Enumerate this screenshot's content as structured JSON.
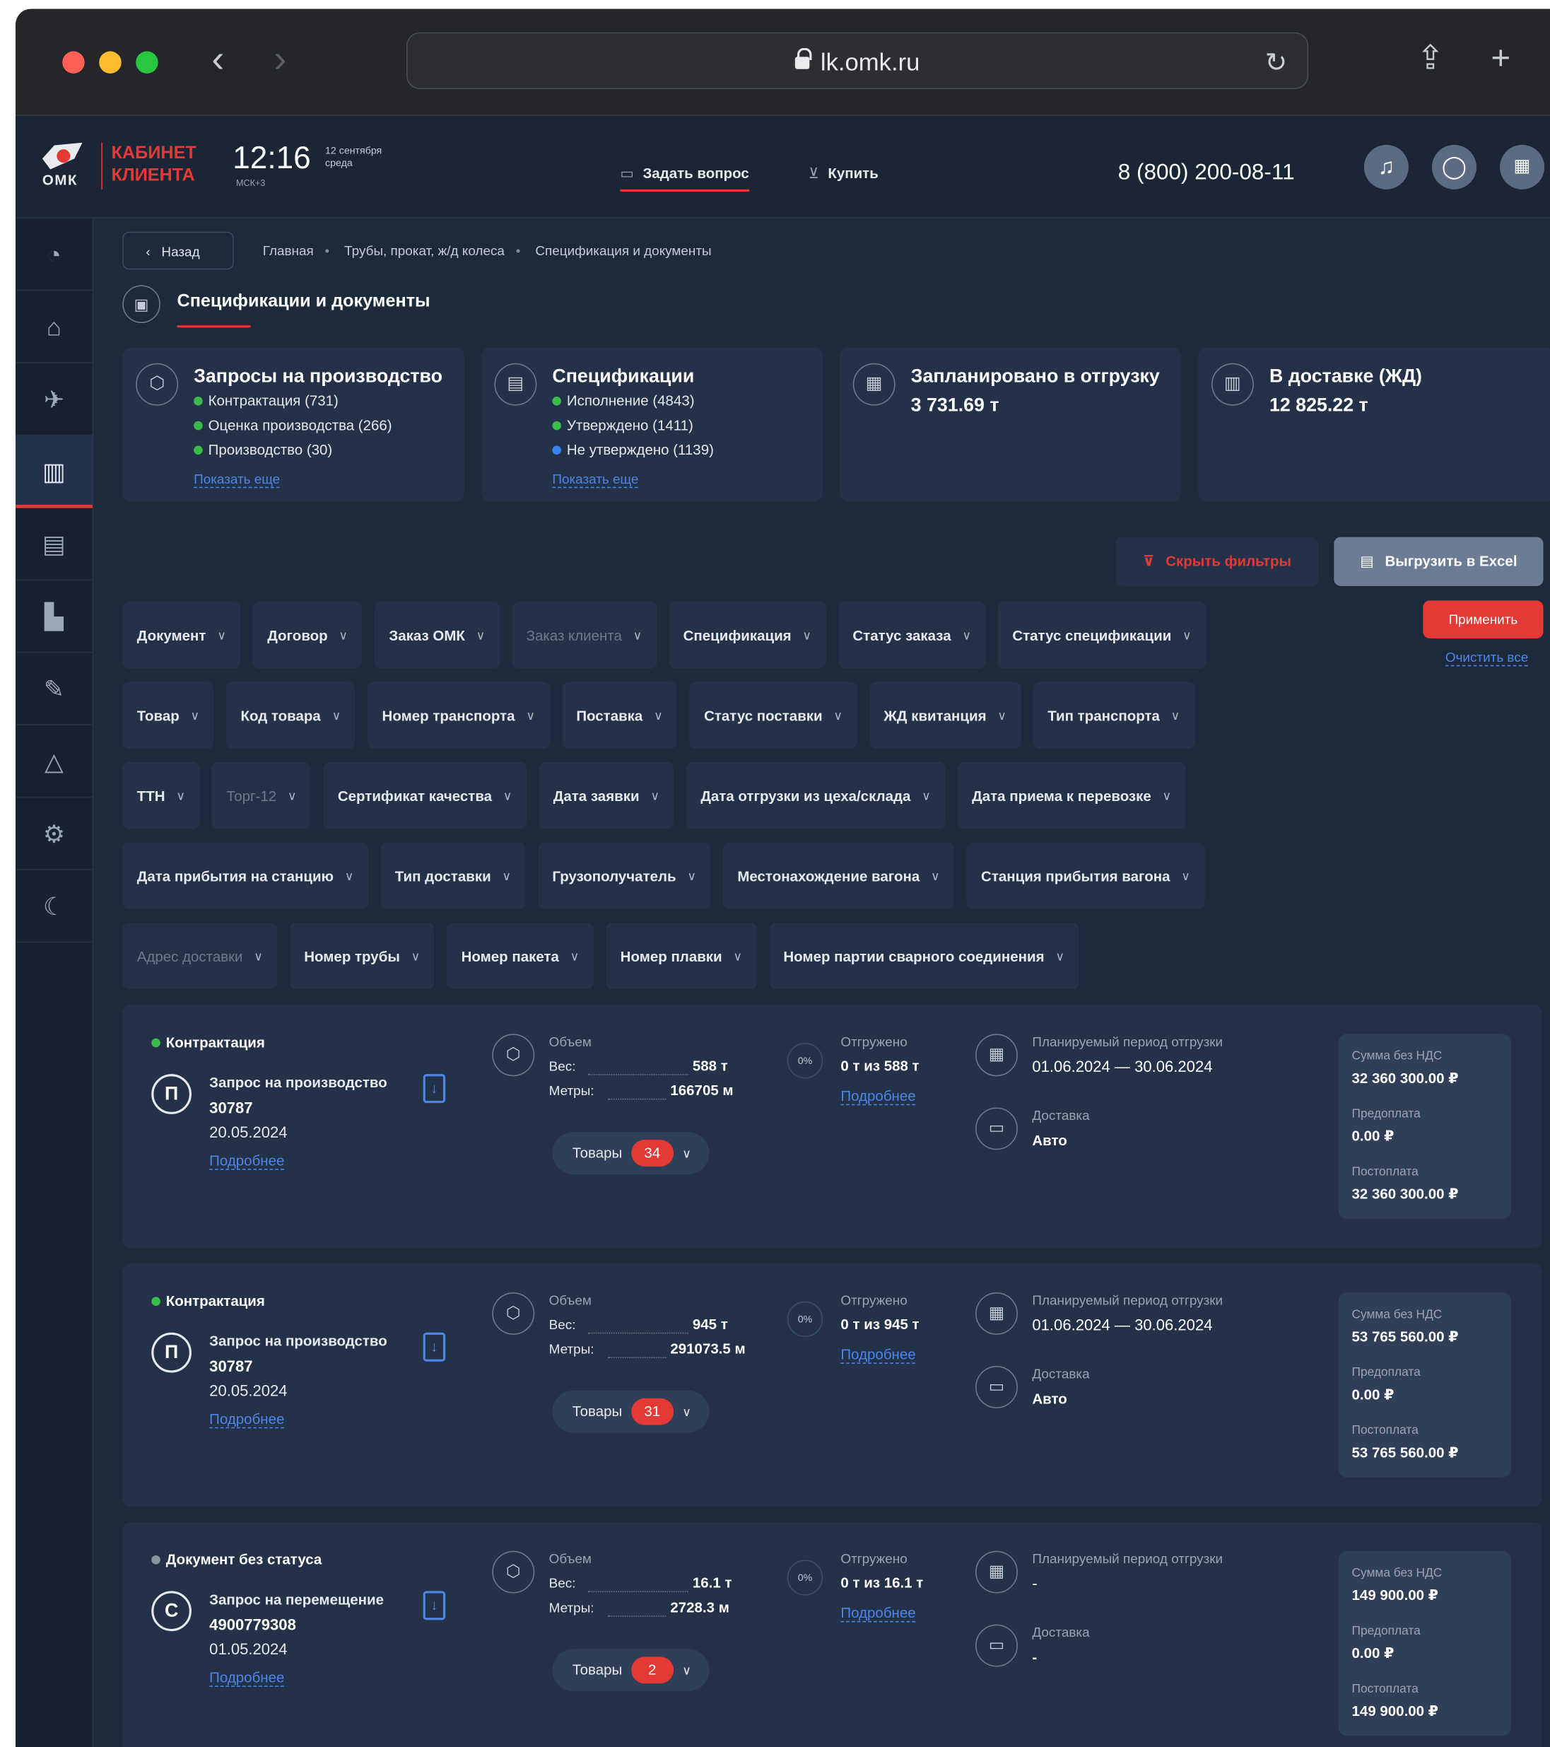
{
  "browser": {
    "url": "lk.omk.ru"
  },
  "header": {
    "logo_text": "ОМК",
    "cabinet_line1": "КАБИНЕТ",
    "cabinet_line2": "КЛИЕНТА",
    "time": "12:16",
    "date_line1": "12 сентября",
    "date_line2": "среда",
    "timezone": "МСК+3",
    "ask_label": "Задать вопрос",
    "buy_label": "Купить",
    "phone": "8 (800) 200-08-11"
  },
  "sidebar": {
    "icons": [
      "pie-chart-icon",
      "home-icon",
      "rocket-icon",
      "wagon-icon",
      "document-icon",
      "factory-icon",
      "tools-icon",
      "warning-icon",
      "settings-icon",
      "moon-icon"
    ],
    "active_index": 3
  },
  "breadcrumb": {
    "back": "Назад",
    "items": [
      "Главная",
      "Трубы, прокат, ж/д колеса",
      "Спецификация и документы"
    ]
  },
  "page_title": "Спецификации и документы",
  "summary_cards": [
    {
      "title": "Запросы на производство",
      "items": [
        {
          "text": "Контрактация (731)",
          "color": "#3dbb4a"
        },
        {
          "text": "Оценка производства (266)",
          "color": "#3dbb4a"
        },
        {
          "text": "Производство (30)",
          "color": "#3dbb4a"
        }
      ],
      "more": "Показать еще"
    },
    {
      "title": "Спецификации",
      "items": [
        {
          "text": "Исполнение (4843)",
          "color": "#3dbb4a"
        },
        {
          "text": "Утверждено (1411)",
          "color": "#3dbb4a"
        },
        {
          "text": "Не утверждено (1139)",
          "color": "#3c82f6"
        }
      ],
      "more": "Показать еще"
    },
    {
      "title": "Запланировано в отгрузку",
      "value": "3 731.69 т"
    },
    {
      "title": "В доставке (ЖД)",
      "value": "12 825.22 т"
    }
  ],
  "actions": {
    "hide_filters": "Скрыть фильтры",
    "export": "Выгрузить в Excel",
    "apply": "Применить",
    "clear": "Очистить все"
  },
  "filters": {
    "row1": [
      "Документ",
      "Договор",
      "Заказ ОМК",
      "Заказ клиента",
      "Спецификация",
      "Статус заказа",
      "Статус спецификации"
    ],
    "row2": [
      "Товар",
      "Код товара",
      "Номер транспорта",
      "Поставка",
      "Статус поставки",
      "ЖД квитанция",
      "Тип транспорта"
    ],
    "row3": [
      "ТТН",
      "Торг-12",
      "Сертификат качества",
      "Дата заявки",
      "Дата отгрузки из цеха/склада",
      "Дата приема к перевозке"
    ],
    "row4": [
      "Дата прибытия на станцию",
      "Тип доставки",
      "Грузополучатель",
      "Местонахождение вагона",
      "Станция прибытия вагона"
    ],
    "row5": [
      "Адрес доставки",
      "Номер трубы",
      "Номер пакета",
      "Номер плавки",
      "Номер партии сварного соединения"
    ]
  },
  "labels": {
    "volume": "Объем",
    "weight": "Вес:",
    "meters": "Метры:",
    "shipped": "Отгружено",
    "details": "Подробнее",
    "period": "Планируемый период отгрузки",
    "delivery": "Доставка",
    "goods": "Товары",
    "sum_no_vat": "Сумма без НДС",
    "prepay": "Предоплата",
    "postpay": "Постоплата",
    "percent": "0%"
  },
  "orders": [
    {
      "status": "Контрактация",
      "status_color": "#3dbb4a",
      "letter": "П",
      "type": "Запрос на производство",
      "number": "30787",
      "date": "20.05.2024",
      "weight": "588 т",
      "meters": "166705 м",
      "shipped": "0 т из 588 т",
      "period": "01.06.2024 — 30.06.2024",
      "delivery": "Авто",
      "goods_count": "34",
      "sum": "32 360 300.00 ₽",
      "prepay": "0.00 ₽",
      "postpay": "32 360 300.00 ₽"
    },
    {
      "status": "Контрактация",
      "status_color": "#3dbb4a",
      "letter": "П",
      "type": "Запрос на производство",
      "number": "30787",
      "date": "20.05.2024",
      "weight": "945 т",
      "meters": "291073.5 м",
      "shipped": "0 т из 945 т",
      "period": "01.06.2024 — 30.06.2024",
      "delivery": "Авто",
      "goods_count": "31",
      "sum": "53 765 560.00 ₽",
      "prepay": "0.00 ₽",
      "postpay": "53 765 560.00 ₽"
    },
    {
      "status": "Документ без статуса",
      "status_color": "#8a94a3",
      "letter": "С",
      "type": "Запрос на перемещение",
      "number": "4900779308",
      "date": "01.05.2024",
      "weight": "16.1 т",
      "meters": "2728.3 м",
      "shipped": "0 т из 16.1 т",
      "period": "-",
      "delivery": "-",
      "goods_count": "2",
      "sum": "149 900.00 ₽",
      "prepay": "0.00 ₽",
      "postpay": "149 900.00 ₽"
    }
  ]
}
